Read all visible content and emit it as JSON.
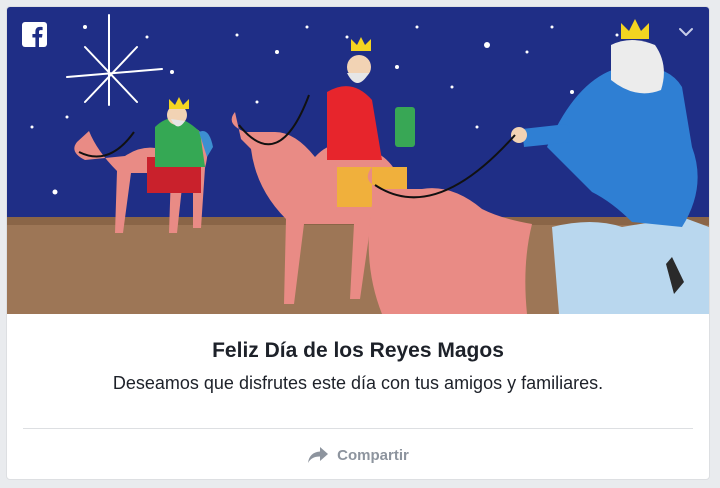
{
  "post": {
    "title": "Feliz Día de los Reyes Magos",
    "subtitle": "Deseamos que disfrutes este día con tus amigos y familiares.",
    "share_label": "Compartir"
  },
  "icons": {
    "brand": "facebook-icon",
    "menu": "chevron-down-icon",
    "share": "share-arrow-icon"
  },
  "colors": {
    "facebook_blue": "#3b5998",
    "night_sky": "#1f2e86",
    "camel_pink": "#e98b85",
    "text_dark": "#1d2129",
    "text_muted": "#8d949e"
  }
}
